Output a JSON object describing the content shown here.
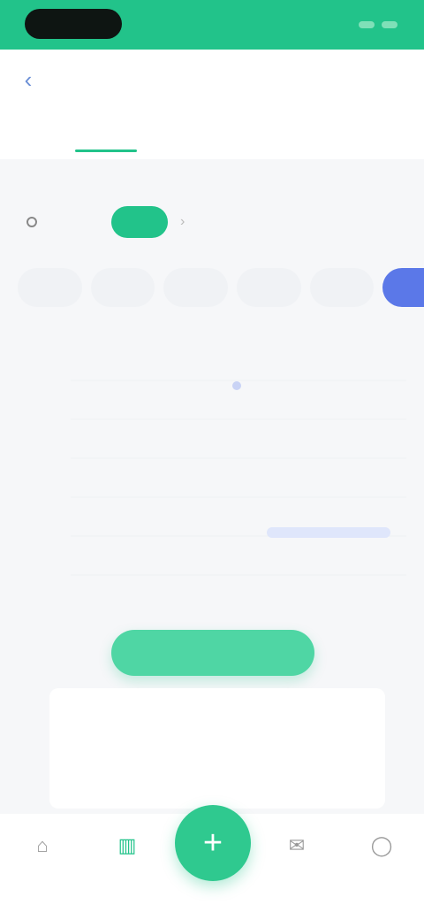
{
  "status_bar": {
    "time": ""
  },
  "header": {
    "title": "",
    "action": "",
    "tabs": [
      {
        "label": "",
        "active": true
      },
      {
        "label": "",
        "active": false
      }
    ]
  },
  "filter": {
    "room": "",
    "period_label": "",
    "period_button": "",
    "more": ""
  },
  "dates": [
    {
      "label": ""
    },
    {
      "label": ""
    },
    {
      "label": ""
    },
    {
      "label": ""
    },
    {
      "label": ""
    },
    {
      "label": "",
      "selected": true
    }
  ],
  "chart": {
    "y_ticks": [
      "",
      "",
      "",
      "",
      "",
      ""
    ],
    "x_ticks": [
      "",
      "",
      ""
    ],
    "series_color": "#5b78e8"
  },
  "cta": {
    "label": ""
  },
  "summary": {
    "title": "",
    "items": [
      {
        "value": "",
        "label": ""
      },
      {
        "value": "",
        "label": ""
      },
      {
        "value": "",
        "label": ""
      }
    ]
  },
  "nav": {
    "items": [
      {
        "label": "",
        "icon": "home-icon"
      },
      {
        "label": "",
        "icon": "chart-icon",
        "active": true
      },
      {
        "label": "",
        "icon": "message-icon"
      },
      {
        "label": "",
        "icon": "profile-icon"
      }
    ],
    "fab_icon": "plus-icon"
  },
  "colors": {
    "brand": "#22c38a",
    "accent": "#5b78e8",
    "background": "#f6f7f9"
  }
}
